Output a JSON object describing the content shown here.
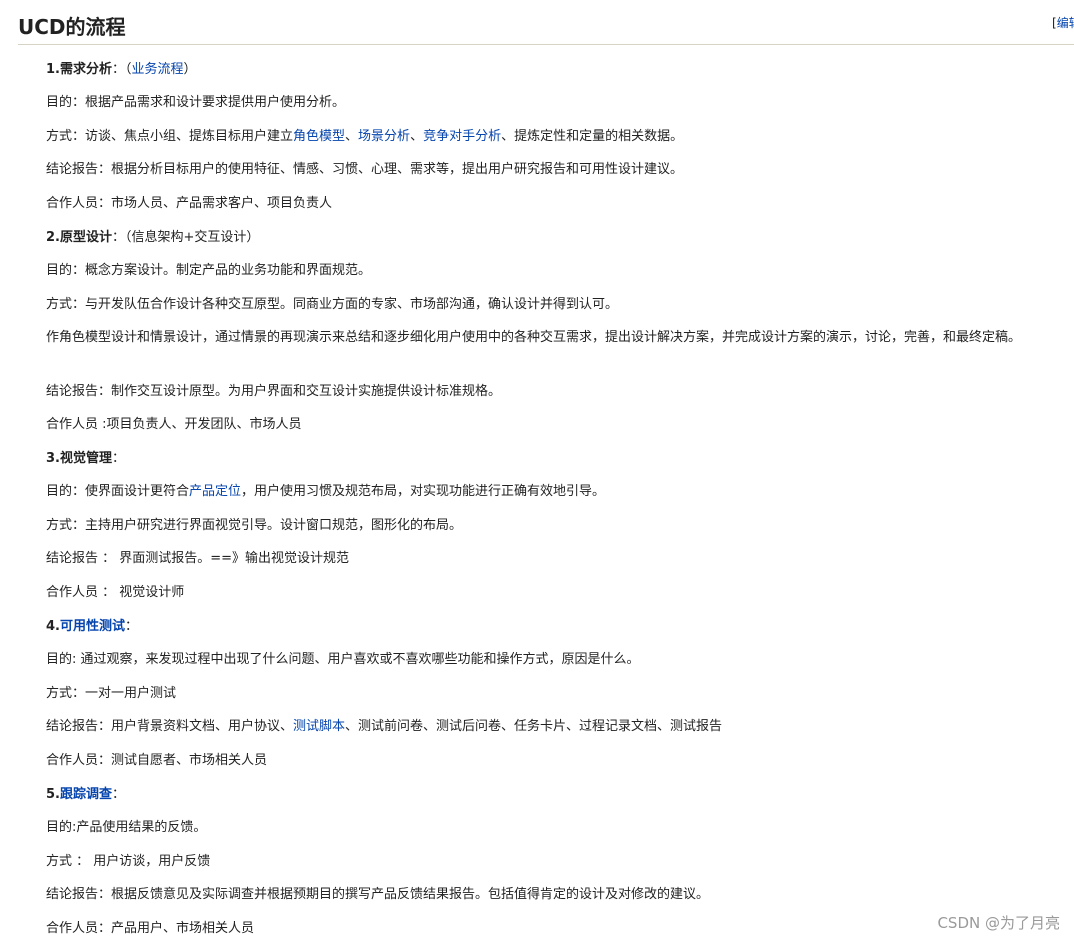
{
  "heading": {
    "title": "UCD的流程",
    "edit_label": "编辑",
    "edit_open": "[",
    "edit_close": "]"
  },
  "sections": [
    {
      "num": "1.",
      "title": "需求分析",
      "colon": "：",
      "paren_open": "（",
      "paren_link": "业务流程",
      "paren_close": "）",
      "purpose": "目的：根据产品需求和设计要求提供用户使用分析。",
      "method": {
        "prefix": "方式：访谈、焦点小组、提炼目标用户建立",
        "link1": "角色模型",
        "sep1": "、",
        "link2": "场景分析",
        "sep2": "、",
        "link3": "竞争对手分析",
        "suffix": "、提炼定性和定量的相关数据。"
      },
      "report": "结论报告：根据分析目标用户的使用特征、情感、习惯、心理、需求等，提出用户研究报告和可用性设计建议。",
      "people": "合作人员：市场人员、产品需求客户、项目负责人"
    },
    {
      "num": "2.",
      "title": "原型设计",
      "colon": "：",
      "sub": "（信息架构+交互设计）",
      "purpose": "目的：概念方案设计。制定产品的业务功能和界面规范。",
      "method": "方式：与开发队伍合作设计各种交互原型。同商业方面的专家、市场部沟通，确认设计并得到认可。",
      "detail": "作角色模型设计和情景设计，通过情景的再现演示来总结和逐步细化用户使用中的各种交互需求，提出设计解决方案，并完成设计方案的演示，讨论，完善，和最终定稿。",
      "report": "结论报告：制作交互设计原型。为用户界面和交互设计实施提供设计标准规格。",
      "people": "合作人员 :项目负责人、开发团队、市场人员"
    },
    {
      "num": "3.",
      "title": "视觉管理",
      "colon": "：",
      "purpose": {
        "prefix": "目的：使界面设计更符合",
        "link": "产品定位",
        "suffix": "，用户使用习惯及规范布局，对实现功能进行正确有效地引导。"
      },
      "method": "方式：主持用户研究进行界面视觉引导。设计窗口规范，图形化的布局。",
      "report": "结论报告 ： 界面测试报告。==》输出视觉设计规范",
      "people": "合作人员 ： 视觉设计师"
    },
    {
      "num": "4.",
      "title_link": "可用性测试",
      "colon": "：",
      "purpose": "目的: 通过观察，来发现过程中出现了什么问题、用户喜欢或不喜欢哪些功能和操作方式，原因是什么。",
      "method": "方式：一对一用户测试",
      "report": {
        "prefix": "结论报告：用户背景资料文档、用户协议、",
        "link": "测试脚本",
        "suffix": "、测试前问卷、测试后问卷、任务卡片、过程记录文档、测试报告"
      },
      "people": "合作人员：测试自愿者、市场相关人员"
    },
    {
      "num": "5.",
      "title_link": "跟踪调查",
      "colon": "：",
      "purpose": "目的:产品使用结果的反馈。",
      "method": "方式 ： 用户访谈，用户反馈",
      "report": "结论报告：根据反馈意见及实际调查并根据预期目的撰写产品反馈结果报告。包括值得肯定的设计及对修改的建议。",
      "people": "合作人员：产品用户、市场相关人员"
    }
  ],
  "watermark": "CSDN @为了月亮",
  "colors": {
    "link": "#0645ad",
    "text": "#222222",
    "heading_rule": "#d6d2c4",
    "watermark": "#9a9a9a"
  }
}
